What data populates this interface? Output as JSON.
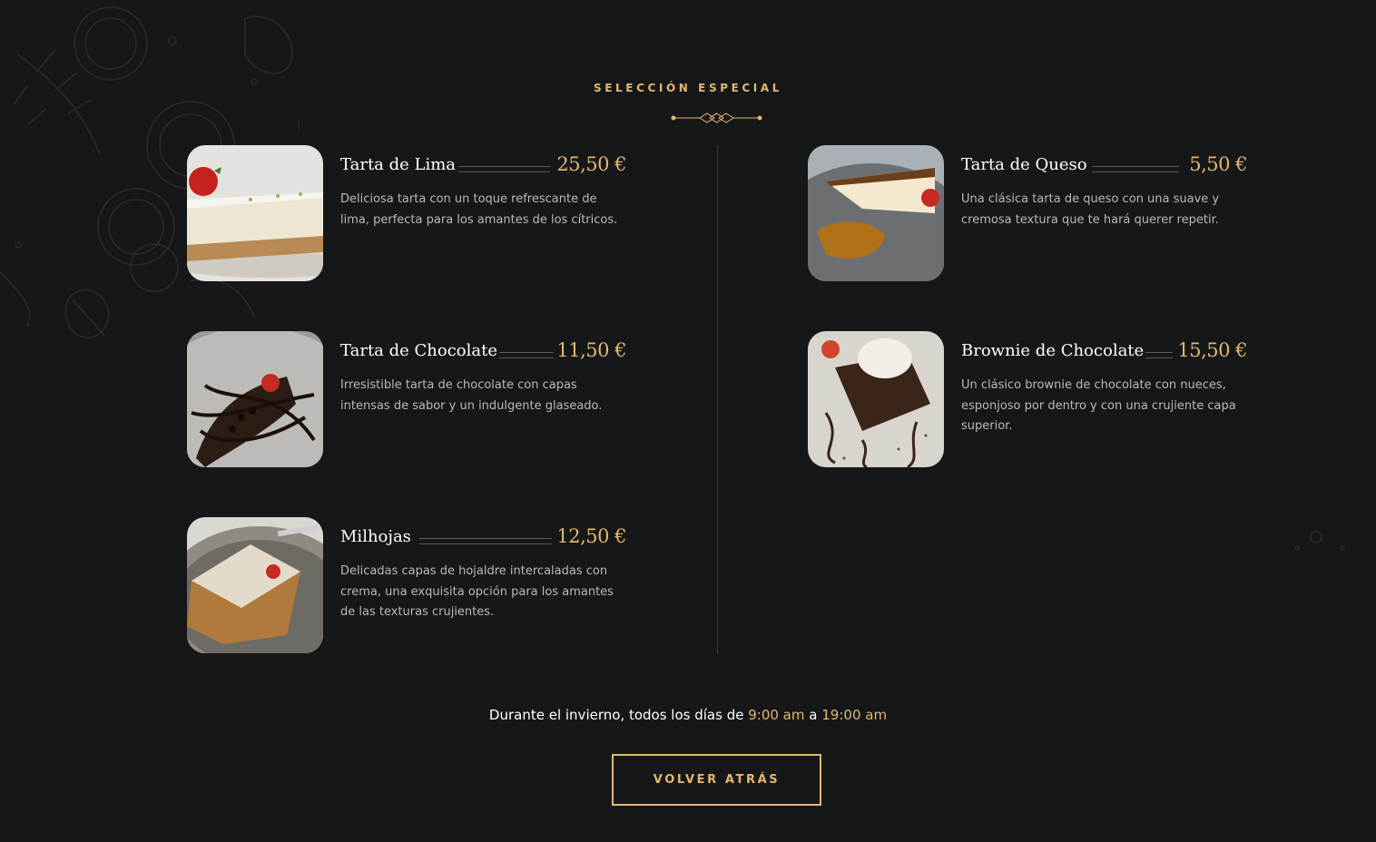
{
  "section": {
    "subtitle": "SELECCIÓN ESPECIAL"
  },
  "menu": {
    "left": [
      {
        "name": "Tarta de Lima",
        "price": "25,50 €",
        "description": "Deliciosa tarta con un toque refrescante de lima, perfecta para los amantes de los cítricos."
      },
      {
        "name": "Tarta de Chocolate",
        "price": "11,50 €",
        "description": "Irresistible tarta de chocolate con capas intensas de sabor y un indulgente glaseado."
      },
      {
        "name": "Milhojas",
        "price": "12,50 €",
        "description": "Delicadas capas de hojaldre intercaladas con crema, una exquisita opción para los amantes de las texturas crujientes."
      }
    ],
    "right": [
      {
        "name": "Tarta de Queso",
        "price": "5,50 €",
        "description": "Una clásica tarta de queso con una suave y cremosa textura que te hará querer repetir."
      },
      {
        "name": "Brownie de Chocolate",
        "price": "15,50 €",
        "description": "Un clásico brownie de chocolate con nueces, esponjoso por dentro y con una crujiente capa superior."
      }
    ]
  },
  "hours": {
    "prefix": "Durante el invierno, todos los días de",
    "start": "9:00 am",
    "connector": "a",
    "end": "19:00 am"
  },
  "back_button": {
    "label": "VOLVER ATRÁS"
  },
  "colors": {
    "background": "#161718",
    "accent": "#e2b76e"
  }
}
